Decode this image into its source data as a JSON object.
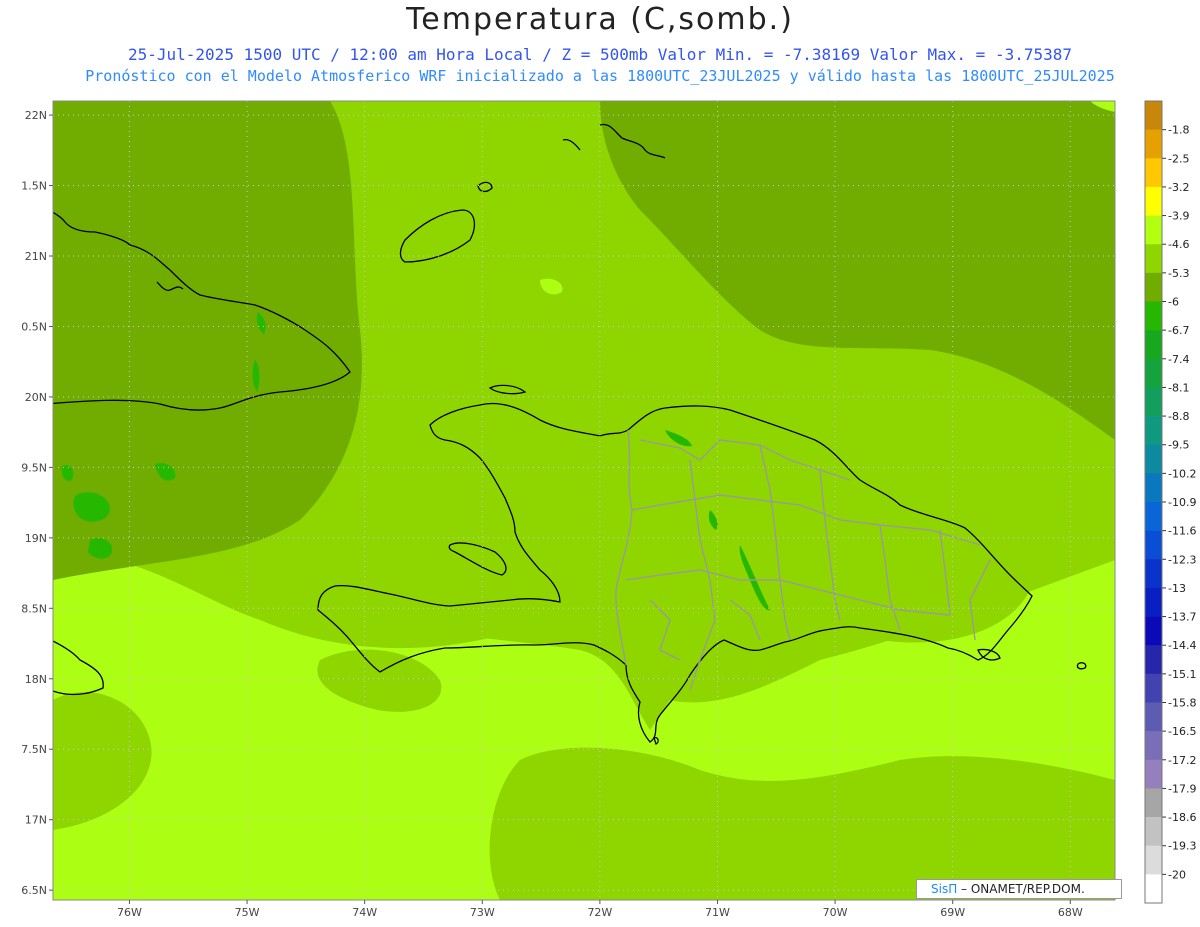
{
  "header": {
    "title": "Temperatura (C,somb.)",
    "subtitle1": "25-Jul-2025  1500 UTC / 12:00 am Hora Local / Z = 500mb  Valor Min. = -7.38169  Valor Max. = -3.75387",
    "subtitle2": "Pronóstico con el Modelo Atmosferico WRF inicializado a las 1800UTC_23JUL2025 y válido hasta las  1800UTC_25JUL2025"
  },
  "axes": {
    "y_ticks": [
      {
        "label": "22N",
        "lat": 22.0
      },
      {
        "label": "1.5N",
        "lat": 21.5
      },
      {
        "label": "21N",
        "lat": 21.0
      },
      {
        "label": "0.5N",
        "lat": 20.5
      },
      {
        "label": "20N",
        "lat": 20.0
      },
      {
        "label": "9.5N",
        "lat": 19.5
      },
      {
        "label": "19N",
        "lat": 19.0
      },
      {
        "label": "8.5N",
        "lat": 18.5
      },
      {
        "label": "18N",
        "lat": 18.0
      },
      {
        "label": "7.5N",
        "lat": 17.5
      },
      {
        "label": "17N",
        "lat": 17.0
      },
      {
        "label": "6.5N",
        "lat": 16.5
      }
    ],
    "x_ticks": [
      {
        "label": "76W",
        "lon": -76
      },
      {
        "label": "75W",
        "lon": -75
      },
      {
        "label": "74W",
        "lon": -74
      },
      {
        "label": "73W",
        "lon": -73
      },
      {
        "label": "72W",
        "lon": -72
      },
      {
        "label": "71W",
        "lon": -71
      },
      {
        "label": "70W",
        "lon": -70
      },
      {
        "label": "69W",
        "lon": -69
      },
      {
        "label": "68W",
        "lon": -68
      }
    ],
    "lat_range": [
      16.43,
      22.1
    ],
    "lon_range": [
      -76.65,
      -67.62
    ]
  },
  "colorbar": {
    "levels": [
      {
        "label": "-1.8",
        "color": "#c8860a"
      },
      {
        "label": "-2.5",
        "color": "#e6a000"
      },
      {
        "label": "-3.2",
        "color": "#ffc800"
      },
      {
        "label": "-3.9",
        "color": "#ffff00"
      },
      {
        "label": "-4.6",
        "color": "#b3ff12"
      },
      {
        "label": "-5.3",
        "color": "#8fd600"
      },
      {
        "label": "-6",
        "color": "#70ad00"
      },
      {
        "label": "-6.7",
        "color": "#26b800"
      },
      {
        "label": "-7.4",
        "color": "#18a81e"
      },
      {
        "label": "-8.1",
        "color": "#14a33c"
      },
      {
        "label": "-8.8",
        "color": "#129e5c"
      },
      {
        "label": "-9.5",
        "color": "#0f9981"
      },
      {
        "label": "-10.2",
        "color": "#0d8aa0"
      },
      {
        "label": "-10.9",
        "color": "#0a78bf"
      },
      {
        "label": "-11.6",
        "color": "#0a66d6"
      },
      {
        "label": "-12.3",
        "color": "#0a4ed6"
      },
      {
        "label": "-13",
        "color": "#0a33cc"
      },
      {
        "label": "-13.7",
        "color": "#0a1fc2"
      },
      {
        "label": "-14.4",
        "color": "#0a0ab8"
      },
      {
        "label": "-15.1",
        "color": "#2626ad"
      },
      {
        "label": "-15.8",
        "color": "#4242b0"
      },
      {
        "label": "-16.5",
        "color": "#5c5cb3"
      },
      {
        "label": "-17.2",
        "color": "#7a6eb8"
      },
      {
        "label": "-17.9",
        "color": "#9580bd"
      },
      {
        "label": "-18.6",
        "color": "#a6a6a6"
      },
      {
        "label": "-19.3",
        "color": "#c2c2c2"
      },
      {
        "label": "-20",
        "color": "#dcdcdc"
      },
      {
        "label": "",
        "color": "#ffffff"
      }
    ]
  },
  "field_colors": {
    "light": "#acff12",
    "mid": "#8fd600",
    "dark": "#70ad00",
    "green": "#26b800",
    "deep": "#18a81e"
  },
  "credit": {
    "brand": "SisΠ",
    "text": " – ONAMET/REP.DOM."
  }
}
